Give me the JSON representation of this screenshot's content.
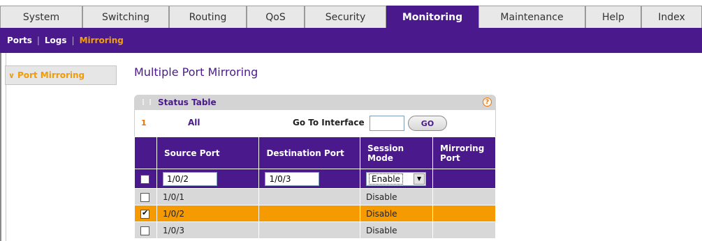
{
  "top_tabs": [
    {
      "label": "System",
      "active": false
    },
    {
      "label": "Switching",
      "active": false
    },
    {
      "label": "Routing",
      "active": false
    },
    {
      "label": "QoS",
      "active": false
    },
    {
      "label": "Security",
      "active": false
    },
    {
      "label": "Monitoring",
      "active": true
    },
    {
      "label": "Maintenance",
      "active": false
    },
    {
      "label": "Help",
      "active": false
    },
    {
      "label": "Index",
      "active": false
    }
  ],
  "sub_nav": [
    {
      "label": "Ports",
      "active": false
    },
    {
      "label": "Logs",
      "active": false
    },
    {
      "label": "Mirroring",
      "active": true
    }
  ],
  "sidebar": {
    "items": [
      {
        "label": "Port Mirroring",
        "chevron": "∨"
      }
    ]
  },
  "page_title": "Multiple Port Mirroring",
  "panel": {
    "title": "Status Table",
    "help_icon": "?",
    "pager": {
      "page_number": "1",
      "all_label": "All"
    },
    "goto": {
      "label": "Go To Interface",
      "value": "",
      "button_label": "GO"
    },
    "columns": [
      "Source Port",
      "Destination Port",
      "Session Mode",
      "Mirroring Port"
    ],
    "edit_row": {
      "source_port": "1/0/2",
      "destination_port": "1/0/3",
      "session_mode": "Enable"
    },
    "rows": [
      {
        "source_port": "1/0/1",
        "destination_port": "",
        "session_mode": "Disable",
        "mirroring_port": "",
        "checked": false
      },
      {
        "source_port": "1/0/2",
        "destination_port": "",
        "session_mode": "Disable",
        "mirroring_port": "",
        "checked": true
      },
      {
        "source_port": "1/0/3",
        "destination_port": "",
        "session_mode": "Disable",
        "mirroring_port": "",
        "checked": false
      }
    ]
  },
  "colors": {
    "brand_purple": "#4a1a8c",
    "accent_orange": "#f59a00",
    "row_gray": "#d8d8d8"
  }
}
